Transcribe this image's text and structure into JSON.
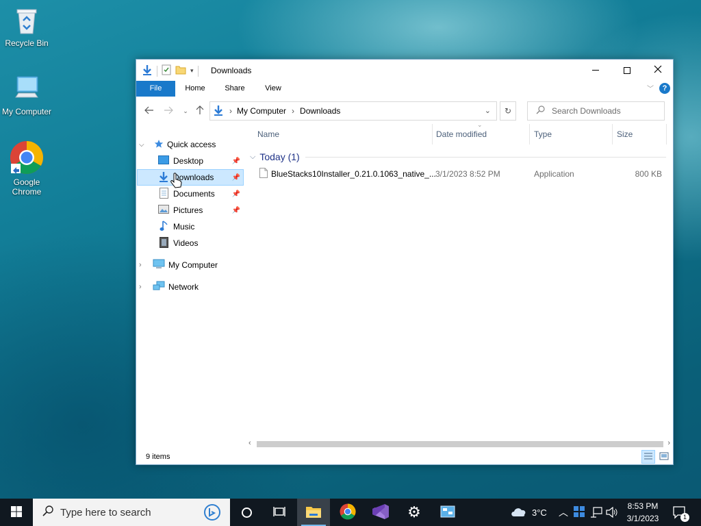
{
  "desktop": {
    "icons": [
      {
        "label": "Recycle Bin",
        "icon": "recycle-bin-icon"
      },
      {
        "label": "My Computer",
        "icon": "computer-icon"
      },
      {
        "label": "Google Chrome",
        "icon": "chrome-icon"
      }
    ]
  },
  "window": {
    "title": "Downloads",
    "ribbon_tabs": [
      "File",
      "Home",
      "Share",
      "View"
    ],
    "breadcrumb": [
      "My Computer",
      "Downloads"
    ],
    "search_placeholder": "Search Downloads",
    "accent": "#1979ca"
  },
  "nav_pane": {
    "quick_access": "Quick access",
    "items": [
      {
        "label": "Desktop",
        "pinned": true,
        "icon": "desktop-icon"
      },
      {
        "label": "Downloads",
        "pinned": true,
        "icon": "download-arrow-icon",
        "selected": true
      },
      {
        "label": "Documents",
        "pinned": true,
        "icon": "document-icon"
      },
      {
        "label": "Pictures",
        "pinned": true,
        "icon": "pictures-icon"
      },
      {
        "label": "Music",
        "pinned": false,
        "icon": "music-icon"
      },
      {
        "label": "Videos",
        "pinned": false,
        "icon": "video-icon"
      }
    ],
    "my_computer": "My Computer",
    "network": "Network"
  },
  "file_list": {
    "columns": [
      "Name",
      "Date modified",
      "Type",
      "Size"
    ],
    "group": "Today (1)",
    "files": [
      {
        "name": "BlueStacks10Installer_0.21.0.1063_native_...",
        "date": "3/1/2023 8:52 PM",
        "type": "Application",
        "size": "800 KB"
      }
    ]
  },
  "status": {
    "items": "9 items"
  },
  "taskbar": {
    "search_placeholder": "Type here to search",
    "weather": "3°C",
    "time": "8:53 PM",
    "date": "3/1/2023",
    "notification_count": "1"
  }
}
